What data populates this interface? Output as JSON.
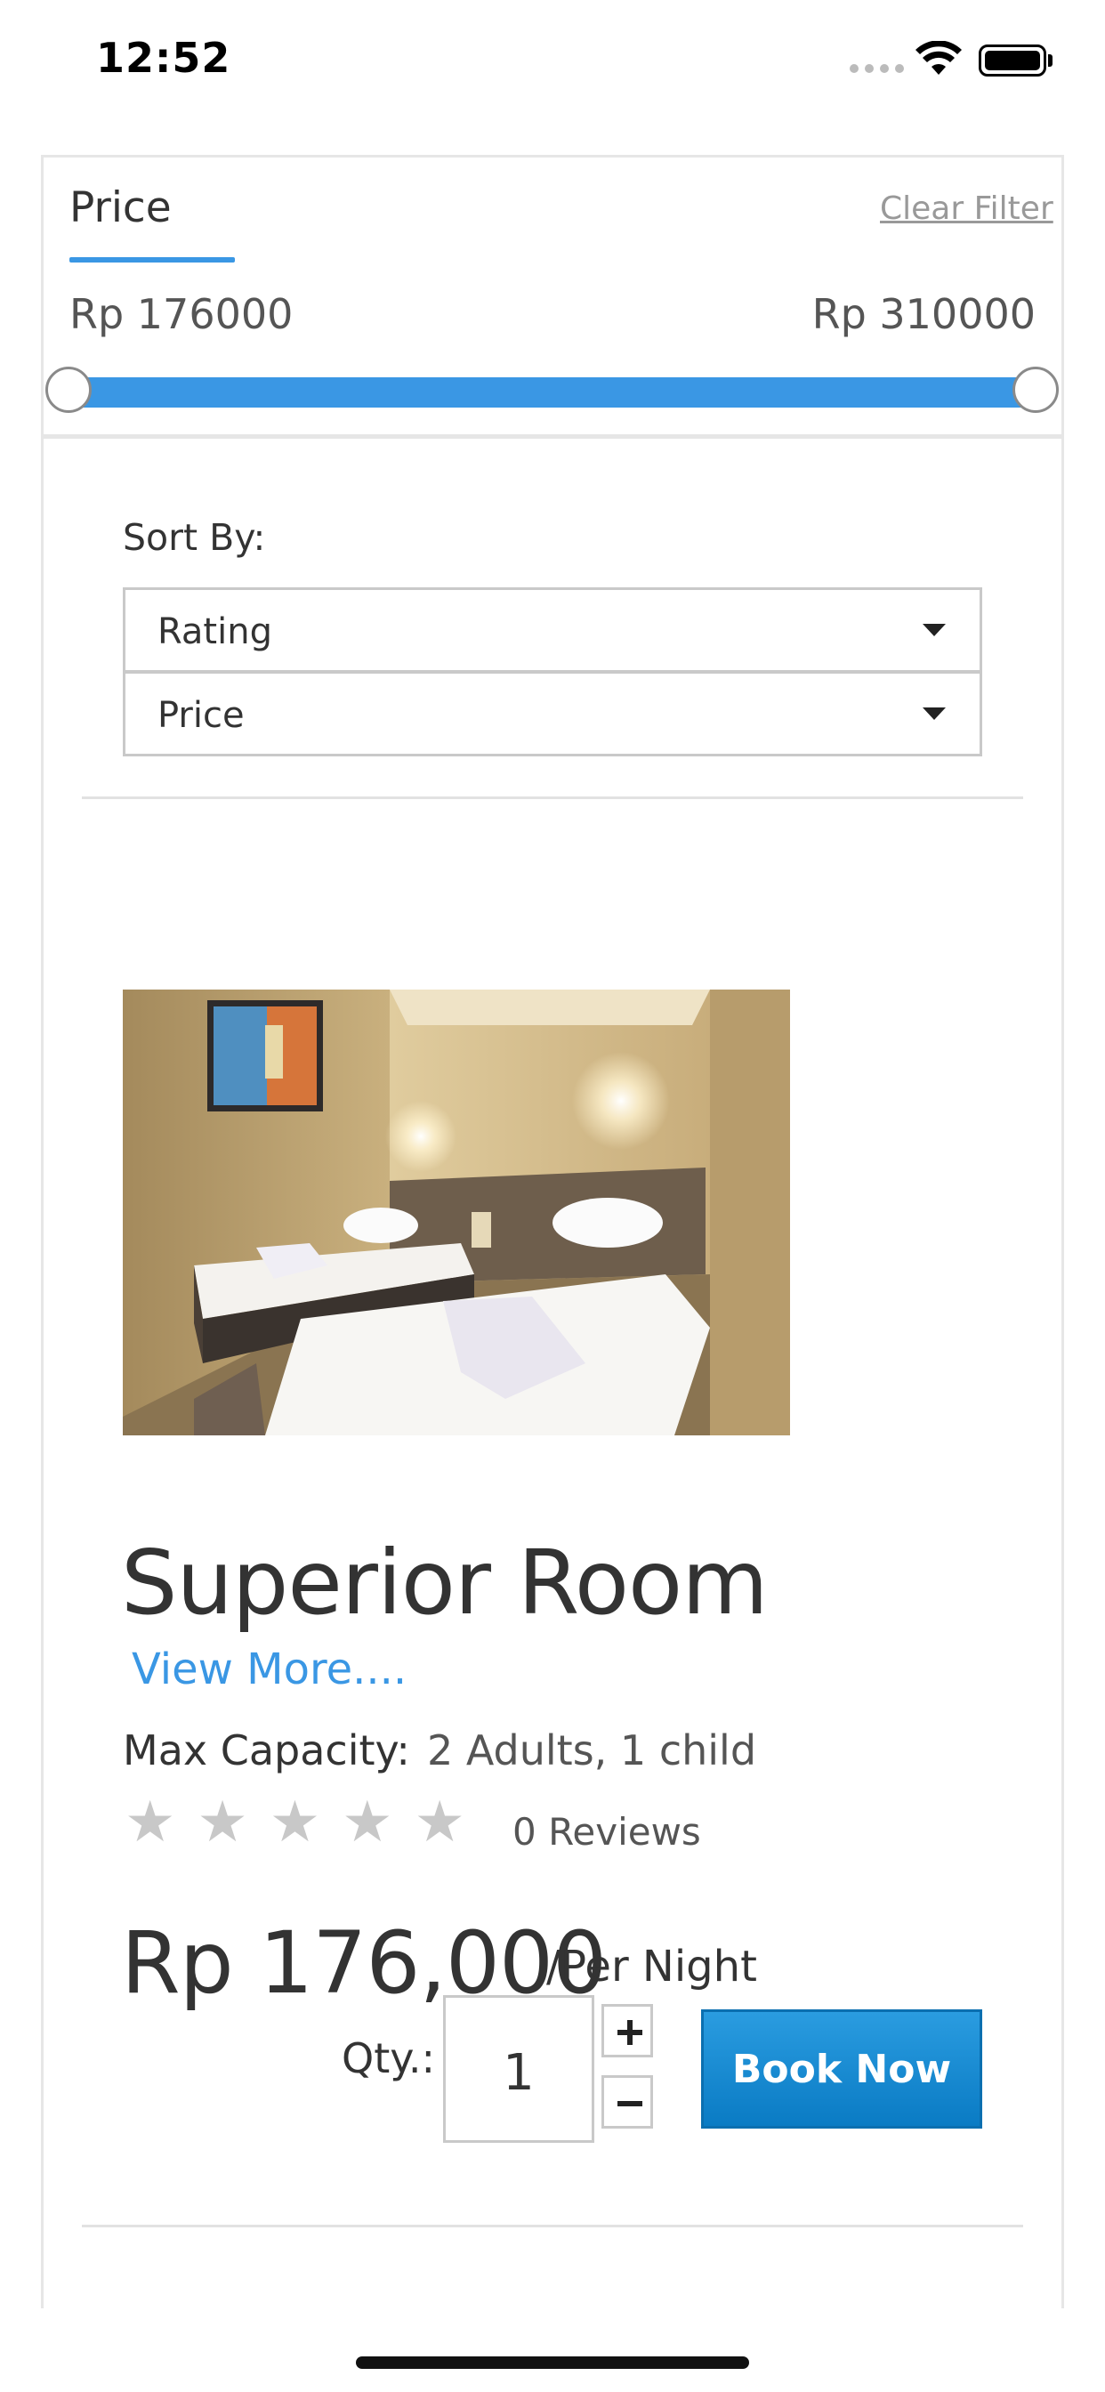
{
  "status_bar": {
    "time": "12:52"
  },
  "filter": {
    "tab_label": "Price",
    "clear_label": "Clear Filter",
    "min_price": "Rp 176000",
    "max_price": "Rp 310000",
    "slider_min_fraction": 0,
    "slider_max_fraction": 1,
    "accent_color": "#3a97e4"
  },
  "sort": {
    "label": "Sort By:",
    "selects": [
      {
        "value": "Rating"
      },
      {
        "value": "Price"
      }
    ]
  },
  "room": {
    "title": "Superior Room",
    "view_more": "View More....",
    "capacity_label": "Max Capacity:",
    "capacity_value": "2 Adults, 1 child",
    "rating_stars": 0,
    "rating_max": 5,
    "reviews": "0 Reviews",
    "price": "Rp 176,000",
    "per_night": "/Per Night",
    "qty_label": "Qty.:",
    "qty_value": "1",
    "book_label": "Book Now",
    "book_color": "#1185cf"
  }
}
